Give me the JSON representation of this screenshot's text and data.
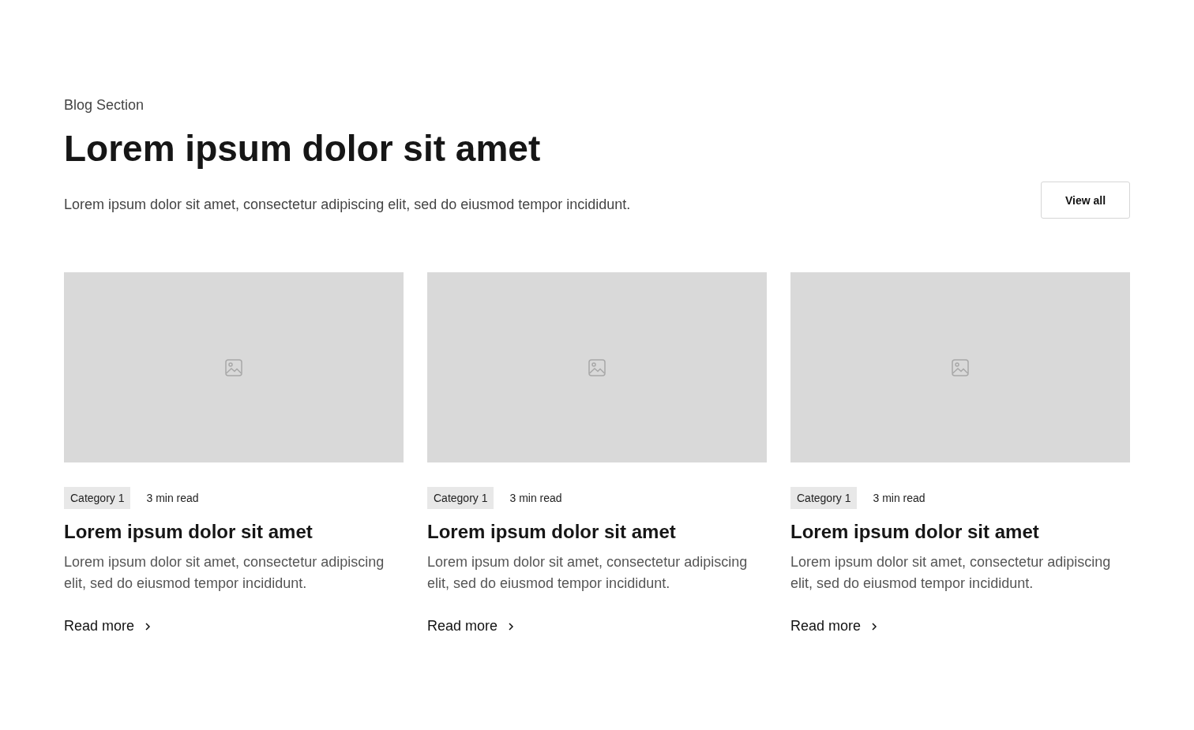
{
  "section_label": "Blog Section",
  "heading": "Lorem ipsum dolor sit amet",
  "description": "Lorem ipsum dolor sit amet, consectetur adipiscing elit, sed do eiusmod tempor incididunt.",
  "view_all_button": "View all",
  "posts": [
    {
      "category": "Category 1",
      "read_time": "3 min read",
      "title": "Lorem ipsum dolor sit amet",
      "excerpt": "Lorem ipsum dolor sit amet, consectetur adipiscing elit, sed do eiusmod tempor incididunt.",
      "link": "Read more"
    },
    {
      "category": "Category 1",
      "read_time": "3 min read",
      "title": "Lorem ipsum dolor sit amet",
      "excerpt": "Lorem ipsum dolor sit amet, consectetur adipiscing elit, sed do eiusmod tempor incididunt.",
      "link": "Read more"
    },
    {
      "category": "Category 1",
      "read_time": "3 min read",
      "title": "Lorem ipsum dolor sit amet",
      "excerpt": "Lorem ipsum dolor sit amet, consectetur adipiscing elit, sed do eiusmod tempor incididunt.",
      "link": "Read more"
    }
  ]
}
